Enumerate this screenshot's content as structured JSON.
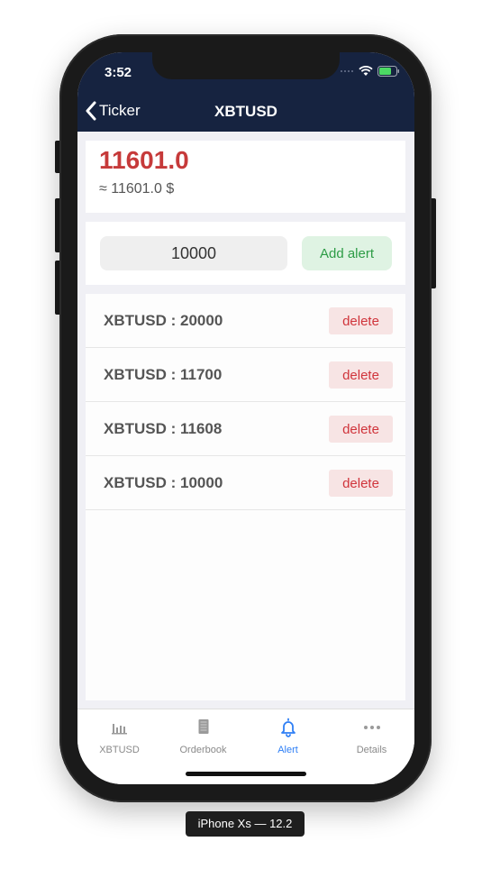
{
  "status_bar": {
    "time": "3:52"
  },
  "nav": {
    "back_label": "Ticker",
    "title": "XBTUSD"
  },
  "price": {
    "value": "11601.0",
    "approx": "≈ 11601.0 $"
  },
  "alert_form": {
    "input_value": "10000",
    "add_button_label": "Add alert"
  },
  "alerts": [
    {
      "label": "XBTUSD : 20000",
      "delete_label": "delete"
    },
    {
      "label": "XBTUSD : 11700",
      "delete_label": "delete"
    },
    {
      "label": "XBTUSD : 11608",
      "delete_label": "delete"
    },
    {
      "label": "XBTUSD : 10000",
      "delete_label": "delete"
    }
  ],
  "tabs": [
    {
      "label": "XBTUSD",
      "icon": "bar-chart-icon",
      "active": false
    },
    {
      "label": "Orderbook",
      "icon": "book-icon",
      "active": false
    },
    {
      "label": "Alert",
      "icon": "bell-icon",
      "active": true
    },
    {
      "label": "Details",
      "icon": "more-dots-icon",
      "active": false
    }
  ],
  "device_caption": "iPhone Xs — 12.2",
  "colors": {
    "nav_background": "#162340",
    "price_red": "#c63a3a",
    "add_alert_green": "#2d9c46",
    "delete_red": "#d0343b",
    "tab_active_blue": "#2f7ff5"
  }
}
